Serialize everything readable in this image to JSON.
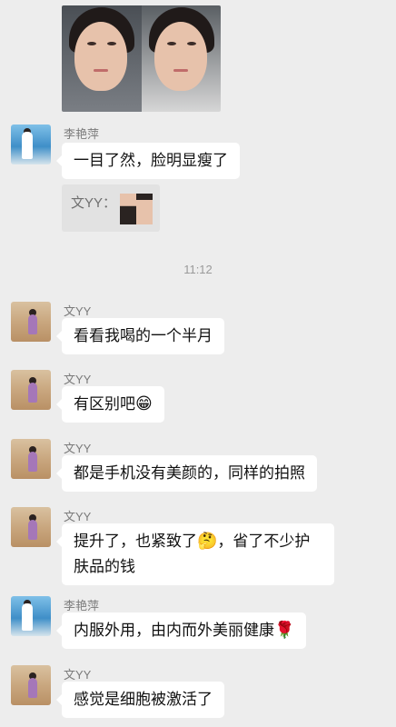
{
  "chat": {
    "time_divider": "11:12",
    "messages": [
      {
        "sender": "李艳萍",
        "text": "一目了然，脸明显瘦了"
      },
      {
        "quote_name": "文YY："
      },
      {
        "sender": "文YY",
        "text": "看看我喝的一个半月"
      },
      {
        "sender": "文YY",
        "text": "有区别吧",
        "emoji": "😁"
      },
      {
        "sender": "文YY",
        "text": "都是手机没有美颜的，同样的拍照"
      },
      {
        "sender": "文YY",
        "text_before_emoji": "提升了，也紧致了",
        "emoji": "🤔",
        "text_after_emoji": "，省了不少护",
        "line2": "肤品的钱"
      },
      {
        "sender": "李艳萍",
        "text": "内服外用，由内而外美丽健康",
        "emoji": "🌹"
      },
      {
        "sender": "文YY",
        "text": "感觉是细胞被激活了"
      }
    ]
  }
}
